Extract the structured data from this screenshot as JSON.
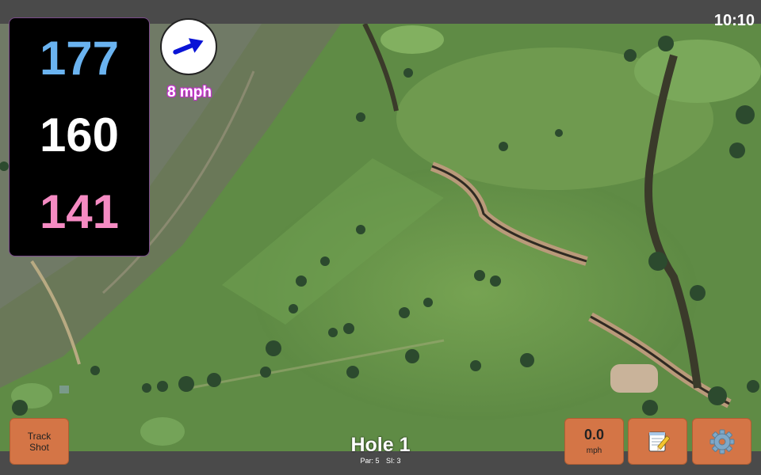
{
  "status": {
    "time": "10:10"
  },
  "distances": {
    "back": "177",
    "center": "160",
    "front": "141"
  },
  "wind": {
    "speed_label": "8 mph",
    "icon": "wind-arrow-icon"
  },
  "hole": {
    "title": "Hole 1",
    "par_label": "Par: 5",
    "si_label": "SI: 3"
  },
  "buttons": {
    "track_shot_line1": "Track",
    "track_shot_line2": "Shot",
    "speed_value": "0.0",
    "speed_unit": "mph",
    "notes_icon": "notepad-icon",
    "settings_icon": "gear-icon"
  },
  "colors": {
    "back": "#6ab3f0",
    "center": "#ffffff",
    "front": "#f58bc3",
    "button": "#d47546",
    "wind_arrow": "#0a14d6"
  }
}
